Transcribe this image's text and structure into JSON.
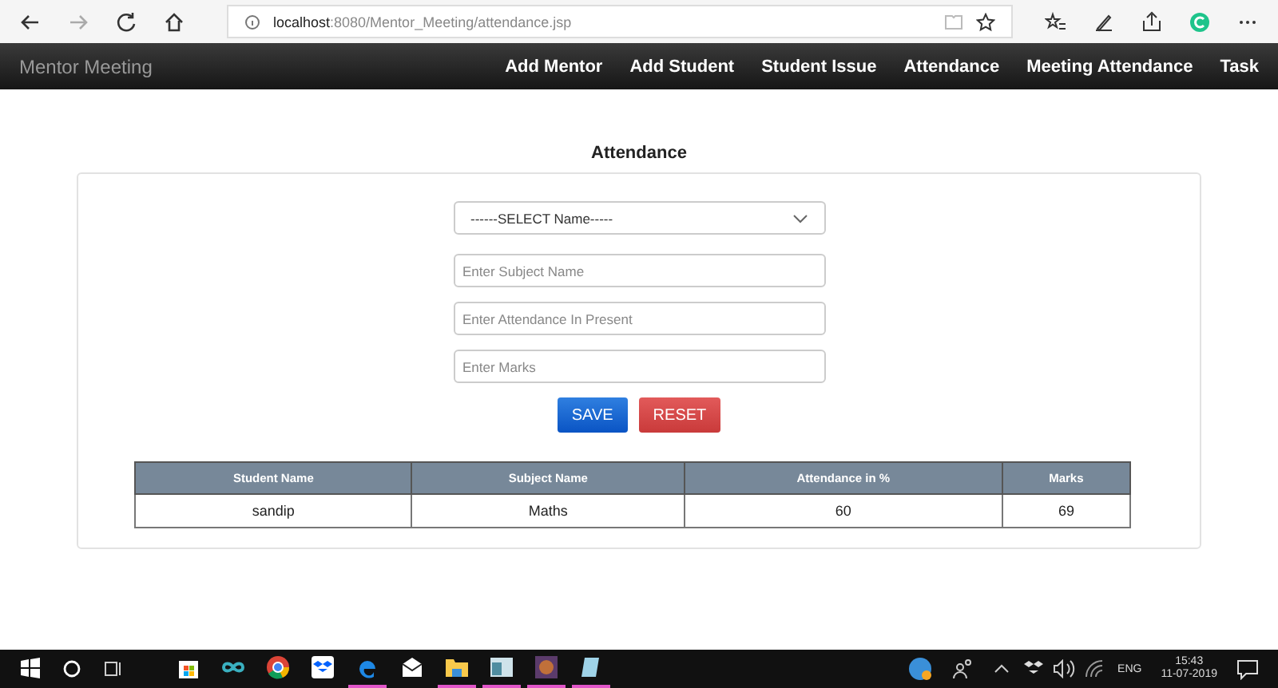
{
  "browser": {
    "url_host": "localhost",
    "url_path": ":8080/Mentor_Meeting/attendance.jsp"
  },
  "navbar": {
    "brand": "Mentor Meeting",
    "links": [
      "Add Mentor",
      "Add Student",
      "Student Issue",
      "Attendance",
      "Meeting Attendance",
      "Task"
    ]
  },
  "page": {
    "title": "Attendance",
    "select": {
      "value": "------SELECT Name-----"
    },
    "fields": [
      {
        "placeholder": "Enter Subject Name"
      },
      {
        "placeholder": "Enter Attendance In Present"
      },
      {
        "placeholder": "Enter Marks"
      }
    ],
    "buttons": [
      {
        "label": "SAVE",
        "kind": "primary"
      },
      {
        "label": "RESET",
        "kind": "danger"
      }
    ]
  },
  "table": {
    "columns": [
      "Student Name",
      "Subject Name",
      "Attendance in %",
      "Marks"
    ],
    "rows": [
      [
        "sandip",
        "Maths",
        "60",
        "69"
      ]
    ]
  },
  "taskbar": {
    "apps": [
      {
        "kind": "store",
        "running": false
      },
      {
        "kind": "infinity",
        "running": false
      },
      {
        "kind": "chrome",
        "running": false
      },
      {
        "kind": "dropbox",
        "running": false
      },
      {
        "kind": "edge",
        "running": true
      },
      {
        "kind": "mail",
        "running": false
      },
      {
        "kind": "folder",
        "running": true
      },
      {
        "kind": "window",
        "running": true
      },
      {
        "kind": "game",
        "running": true
      },
      {
        "kind": "notes",
        "running": true
      }
    ],
    "language": "ENG",
    "time": "15:43",
    "date": "11-07-2019"
  }
}
